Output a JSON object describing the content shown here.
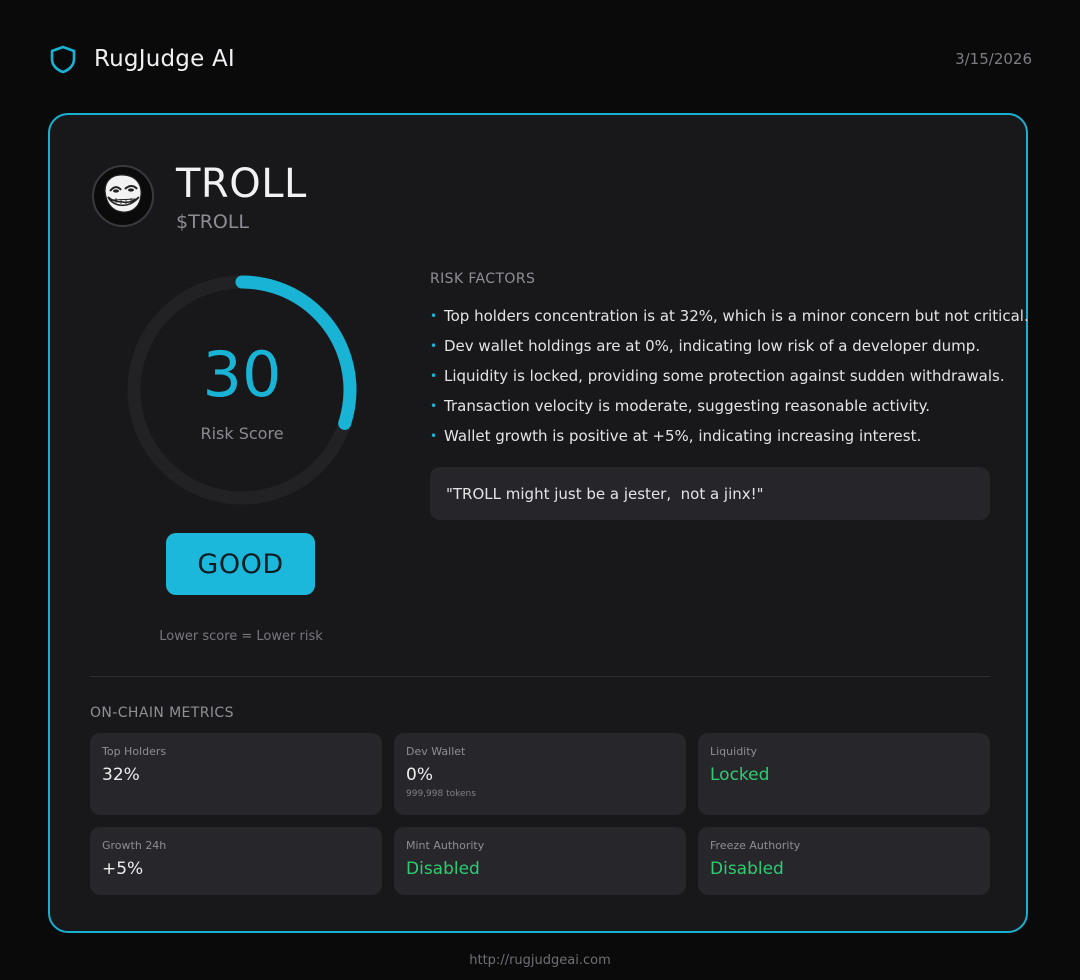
{
  "app": {
    "name": "RugJudge AI",
    "date": "3/15/2026",
    "url": "http://rugjudgeai.com"
  },
  "token": {
    "name": "TROLL",
    "ticker": "$TROLL",
    "avatar_icon": "troll-face-icon"
  },
  "score": {
    "value": 30,
    "max": 100,
    "label": "Risk Score",
    "verdict": "GOOD",
    "hint": "Lower score = Lower risk",
    "color": "#19b3d6"
  },
  "risk_factors": {
    "title": "RISK FACTORS",
    "items": [
      "Top holders concentration is at 32%, which is a minor concern but not critical.",
      "Dev wallet holdings are at 0%, indicating low risk of a developer dump.",
      "Liquidity is locked, providing some protection against sudden withdrawals.",
      "Transaction velocity is moderate, suggesting reasonable activity.",
      "Wallet growth is positive at +5%, indicating increasing interest."
    ],
    "quote": "\"TROLL might just be a jester,  not a jinx!\""
  },
  "metrics": {
    "title": "ON-CHAIN METRICS",
    "items": [
      {
        "label": "Top Holders",
        "value": "32%"
      },
      {
        "label": "Dev Wallet",
        "value": "0%",
        "sub": "999,998 tokens"
      },
      {
        "label": "Liquidity",
        "value": "Locked"
      },
      {
        "label": "Growth 24h",
        "value": "+5%"
      },
      {
        "label": "Mint Authority",
        "value": "Disabled"
      },
      {
        "label": "Freeze Authority",
        "value": "Disabled"
      }
    ]
  },
  "colors": {
    "accent": "#19b3d6",
    "success": "#2ecc71",
    "background": "#0a0a0b",
    "card": "#18181b"
  }
}
